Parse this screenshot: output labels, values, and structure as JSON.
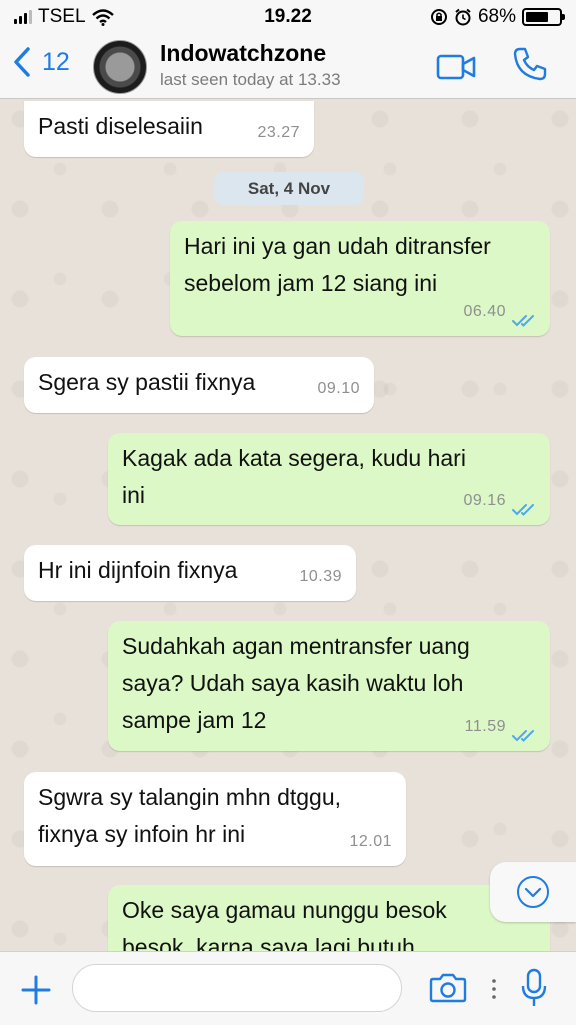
{
  "status_bar": {
    "carrier": "TSEL",
    "time": "19.22",
    "battery_percent": "68%",
    "battery_level": 0.68
  },
  "header": {
    "back_count": "12",
    "contact_name": "Indowatchzone",
    "contact_status": "last seen today at 13.33",
    "icons": [
      "chevron-left-icon",
      "video-call-icon",
      "phone-icon"
    ]
  },
  "chat": {
    "date_separator": "Sat, 4 Nov",
    "messages": [
      {
        "direction": "in",
        "lines": [
          "Pasti diselesaiin"
        ],
        "time": "23.27"
      },
      {
        "direction": "out",
        "lines": [
          "Hari ini ya gan udah ditransfer",
          "sebelom jam 12 siang ini"
        ],
        "time": "06.40",
        "read": true
      },
      {
        "direction": "in",
        "lines": [
          "Sgera sy pastii fixnya"
        ],
        "time": "09.10"
      },
      {
        "direction": "out",
        "lines": [
          "Kagak ada kata segera, kudu hari",
          "ini"
        ],
        "time": "09.16",
        "read": true
      },
      {
        "direction": "in",
        "lines": [
          "Hr ini dijnfoin fixnya"
        ],
        "time": "10.39"
      },
      {
        "direction": "out",
        "lines": [
          "Sudahkah agan mentransfer uang",
          "saya? Udah saya kasih waktu loh",
          "sampe jam 12"
        ],
        "time": "11.59",
        "read": true
      },
      {
        "direction": "in",
        "lines": [
          "Sgwra sy talangin mhn dtggu,",
          "fixnya sy infoin hr ini"
        ],
        "time": "12.01"
      },
      {
        "direction": "out",
        "lines": [
          "Oke saya gamau nunggu besok",
          "besok, karna saya lagi butuh"
        ],
        "time": "",
        "read": false
      }
    ]
  },
  "input_bar": {
    "placeholder": "",
    "icons": [
      "plus-icon",
      "camera-icon",
      "more-dots-icon",
      "microphone-icon"
    ]
  },
  "colors": {
    "accent": "#1f7ce0",
    "outgoing_bubble": "#dcf8c6",
    "incoming_bubble": "#ffffff",
    "read_ticks": "#4fa8ec",
    "chat_background": "#e8e1d9"
  }
}
